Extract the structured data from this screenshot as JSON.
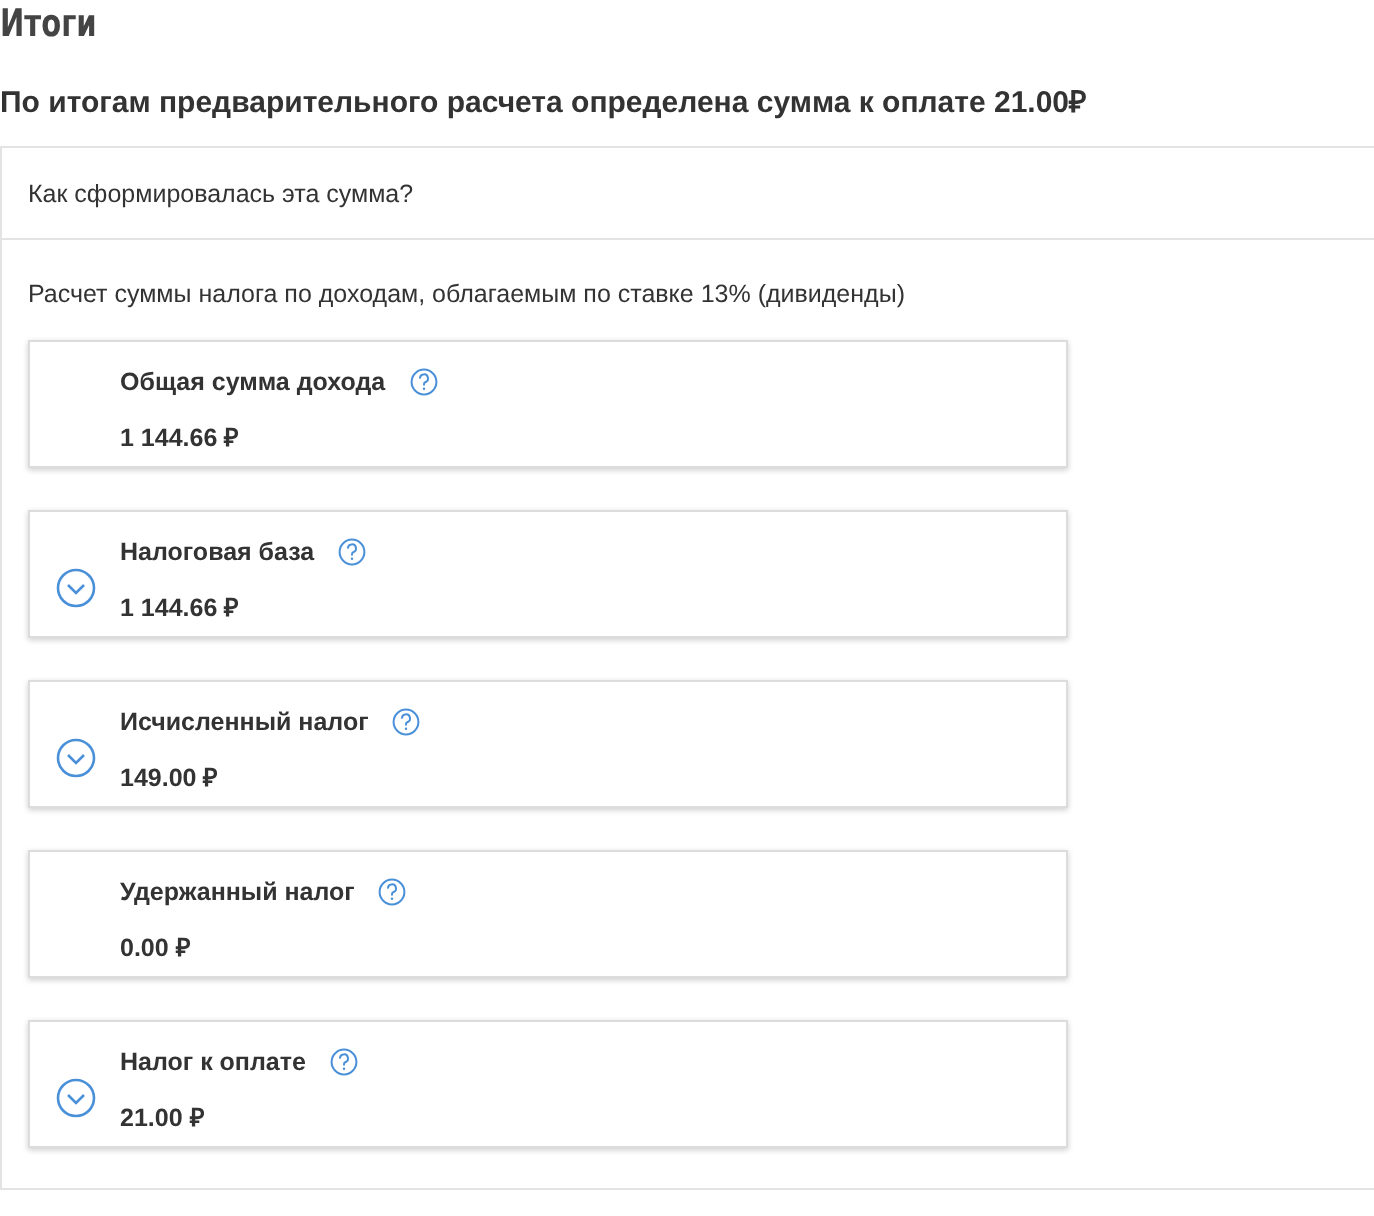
{
  "title": "Итоги",
  "summary": "По итогам предварительного расчета определена сумма к оплате 21.00₽",
  "question": "Как сформировалась эта сумма?",
  "section_title": "Расчет суммы налога по доходам, облагаемым по ставке 13%  (дивиденды)",
  "cards": [
    {
      "label": "Общая сумма дохода",
      "value": "1 144.66 ₽",
      "expandable": false
    },
    {
      "label": "Налоговая база",
      "value": "1 144.66 ₽",
      "expandable": true
    },
    {
      "label": "Исчисленный налог",
      "value": "149.00 ₽",
      "expandable": true
    },
    {
      "label": "Удержанный налог",
      "value": "0.00 ₽",
      "expandable": false
    },
    {
      "label": "Налог к оплате",
      "value": "21.00 ₽",
      "expandable": true
    }
  ]
}
